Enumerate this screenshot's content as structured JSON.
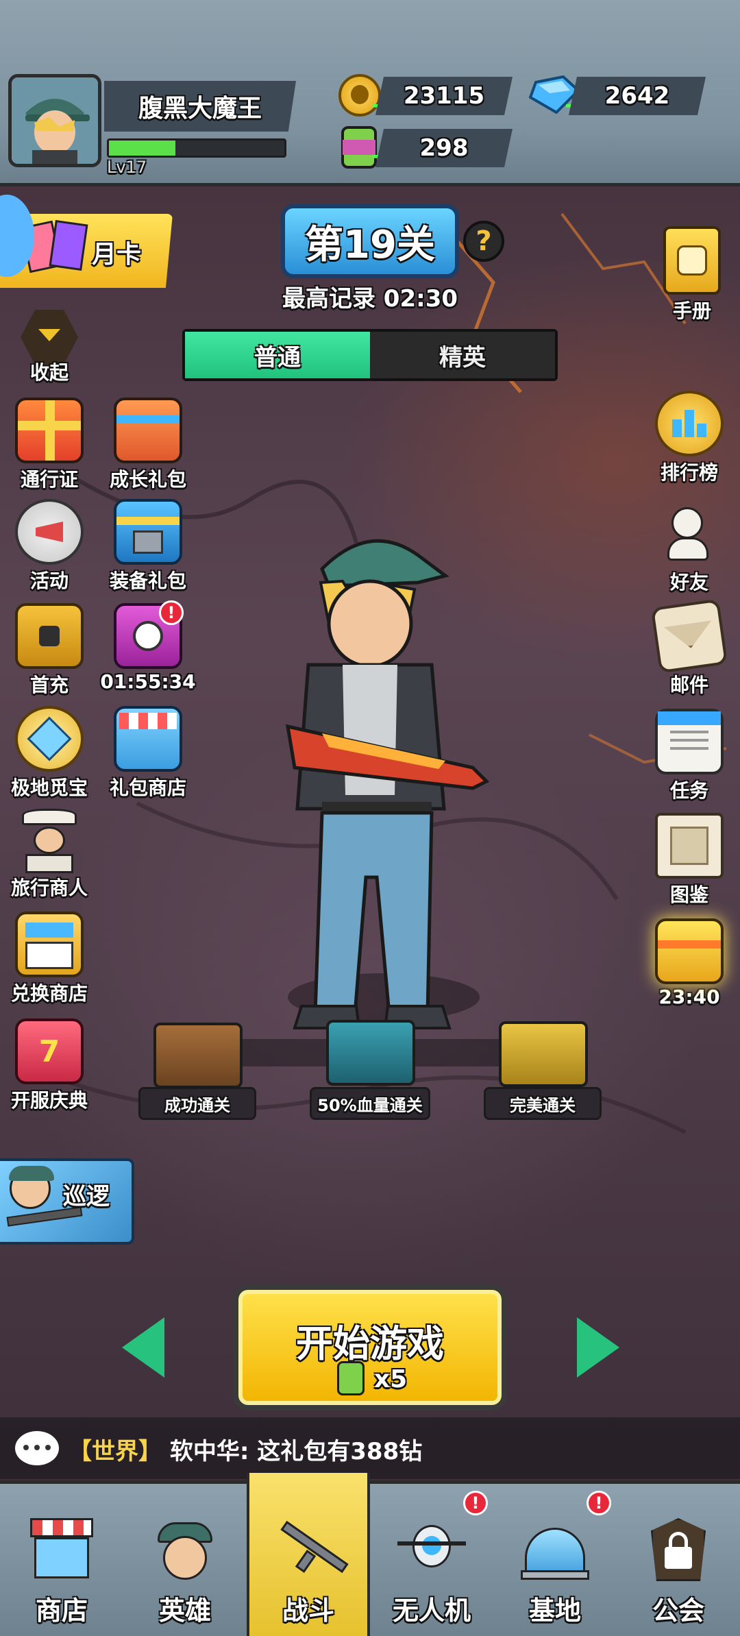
{
  "player": {
    "name": "腹黑大魔王",
    "level": "Lv17",
    "xp_fraction": 0.38
  },
  "resources": {
    "gold": "23115",
    "gems": "2642",
    "energy": "298"
  },
  "stage": {
    "title": "第19关",
    "help": "?",
    "best_record": "最高记录 02:30",
    "tabs": [
      {
        "label": "普通",
        "active": true
      },
      {
        "label": "精英",
        "active": false
      }
    ]
  },
  "left_menu": {
    "monthly_card": "月卡",
    "collapse": "收起",
    "items": [
      {
        "label": "通行证",
        "icon": "gift-box-icon"
      },
      {
        "label": "成长礼包",
        "icon": "growth-gift-icon"
      },
      {
        "label": "活动",
        "icon": "megaphone-icon"
      },
      {
        "label": "装备礼包",
        "icon": "equipment-gift-icon"
      },
      {
        "label": "首充",
        "icon": "treasure-chest-icon"
      },
      {
        "label": "01:55:34",
        "icon": "timed-gift-icon",
        "badge": "!"
      },
      {
        "label": "极地觅宝",
        "icon": "ice-crystal-icon"
      },
      {
        "label": "礼包商店",
        "icon": "gift-shop-icon"
      },
      {
        "label": "旅行商人",
        "icon": "merchant-icon"
      },
      {
        "label": "兑换商店",
        "icon": "exchange-shop-icon"
      },
      {
        "label": "开服庆典",
        "icon": "celebration-chest-icon"
      }
    ],
    "patrol": "巡逻"
  },
  "right_menu": {
    "items": [
      {
        "label": "手册",
        "icon": "handbook-icon"
      },
      {
        "label": "排行榜",
        "icon": "leaderboard-icon"
      },
      {
        "label": "好友",
        "icon": "friends-icon"
      },
      {
        "label": "邮件",
        "icon": "mail-icon"
      },
      {
        "label": "任务",
        "icon": "tasks-icon"
      },
      {
        "label": "图鉴",
        "icon": "codex-icon"
      },
      {
        "label": "23:40",
        "icon": "timed-reward-icon"
      }
    ]
  },
  "chests": [
    {
      "label": "成功通关",
      "color": "#8a5a2f"
    },
    {
      "label": "50%血量通关",
      "color": "#2f7c8c"
    },
    {
      "label": "完美通关",
      "color": "#c9a22b"
    }
  ],
  "start": {
    "label": "开始游戏",
    "cost": "x5"
  },
  "chat": {
    "channel": "【世界】",
    "message": "软中华: 这礼包有388钻"
  },
  "nav": [
    {
      "label": "商店",
      "icon": "shop-icon"
    },
    {
      "label": "英雄",
      "icon": "hero-icon"
    },
    {
      "label": "战斗",
      "icon": "rifle-icon",
      "active": true
    },
    {
      "label": "无人机",
      "icon": "drone-icon",
      "badge": "!"
    },
    {
      "label": "基地",
      "icon": "base-dome-icon",
      "badge": "!"
    },
    {
      "label": "公会",
      "icon": "lock-icon"
    }
  ],
  "colors": {
    "accent_green": "#21c27d",
    "stage_blue": "#2a8fd6",
    "start_yellow": "#f2b400",
    "badge_red": "#e8283a"
  }
}
